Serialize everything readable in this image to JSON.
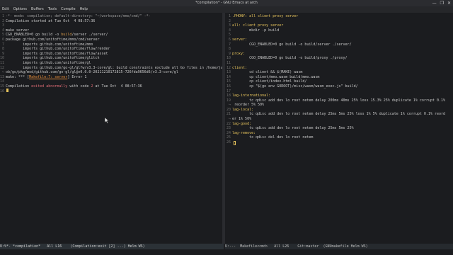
{
  "window": {
    "title": "*compilation* - GNU Emacs at arch",
    "controls": [
      "—",
      "❐",
      "✕"
    ]
  },
  "menu": [
    "Edit",
    "Options",
    "Buffers",
    "Tools",
    "Compile",
    "Help"
  ],
  "left_buffer": {
    "lines": [
      {
        "n": "1",
        "segs": [
          {
            "t": "-*- mode: compilation; default-directory: \"~/workspace/mmo/cmd/\" -*-",
            "c": "c-comment"
          }
        ]
      },
      {
        "n": "2",
        "segs": [
          {
            "t": "Compilation started at Tue Oct  4 08:57:36",
            "c": "c-plain"
          }
        ]
      },
      {
        "n": "3",
        "segs": []
      },
      {
        "n": "4",
        "segs": [
          {
            "t": "make server",
            "c": "c-plain"
          }
        ]
      },
      {
        "n": "5",
        "segs": [
          {
            "t": "CGO_ENABLED=0 go build -o ",
            "c": "c-plain"
          },
          {
            "t": "build",
            "c": "c-var"
          },
          {
            "t": "/server ./server/",
            "c": "c-plain"
          }
        ]
      },
      {
        "n": "6",
        "segs": [
          {
            "t": "package github.com/unitoftime/mmo/cmd/server",
            "c": "c-plain"
          }
        ]
      },
      {
        "n": "7",
        "segs": [
          {
            "t": "        imports github.com/unitoftime/mmo",
            "c": "c-plain"
          }
        ]
      },
      {
        "n": "8",
        "segs": [
          {
            "t": "        imports github.com/unitoftime/flow/render",
            "c": "c-plain"
          }
        ]
      },
      {
        "n": "9",
        "segs": [
          {
            "t": "        imports github.com/unitoftime/flow/asset",
            "c": "c-plain"
          }
        ]
      },
      {
        "n": "10",
        "segs": [
          {
            "t": "        imports github.com/unitoftime/glitch",
            "c": "c-plain"
          }
        ]
      },
      {
        "n": "11",
        "segs": [
          {
            "t": "        imports github.com/unitoftime/gl",
            "c": "c-plain"
          }
        ]
      },
      {
        "n": "12",
        "segs": [
          {
            "t": "        imports github.com/go-gl/glfw/v3.3-core/gl: build constraints exclude all Go files in /home/jac",
            "c": "c-plain"
          }
        ]
      },
      {
        "n": "↪",
        "segs": [
          {
            "t": "ob/go/pkg/mod/github.com/go-gl/gl@v0.0.0-20211210172815-726fda9656d6/v3.3-core/gl",
            "c": "c-plain"
          }
        ]
      },
      {
        "n": "13",
        "segs": [
          {
            "t": "make: *** [",
            "c": "c-plain"
          },
          {
            "t": "Makefile:7: server",
            "c": "c-link"
          },
          {
            "t": "] Error 1",
            "c": "c-plain"
          }
        ]
      },
      {
        "n": "14",
        "segs": []
      },
      {
        "n": "15",
        "segs": [
          {
            "t": "Compilation ",
            "c": "c-plain"
          },
          {
            "t": "exited abnormally",
            "c": "c-err"
          },
          {
            "t": " with code ",
            "c": "c-plain"
          },
          {
            "t": "2",
            "c": "c-err"
          },
          {
            "t": " at Tue Oct  4 08:57:36",
            "c": "c-plain"
          }
        ]
      },
      {
        "n": "16",
        "segs": []
      }
    ]
  },
  "right_buffer": {
    "lines": [
      {
        "n": "1",
        "segs": [
          {
            "t": ".PHONY: all client proxy server",
            "c": "c-target"
          }
        ]
      },
      {
        "n": "2",
        "segs": []
      },
      {
        "n": "3",
        "segs": [
          {
            "t": "all: client proxy server",
            "c": "c-target"
          }
        ]
      },
      {
        "n": "4",
        "segs": [
          {
            "t": "        mkdir -p build",
            "c": "c-plain"
          }
        ]
      },
      {
        "n": "5",
        "segs": []
      },
      {
        "n": "6",
        "segs": [
          {
            "t": "server:",
            "c": "c-target"
          }
        ]
      },
      {
        "n": "7",
        "segs": [
          {
            "t": "        CGO_ENABLED=0 go build -o build/server ./server/",
            "c": "c-plain"
          }
        ]
      },
      {
        "n": "8",
        "segs": []
      },
      {
        "n": "9",
        "segs": [
          {
            "t": "proxy:",
            "c": "c-target"
          }
        ]
      },
      {
        "n": "10",
        "segs": [
          {
            "t": "        CGO_ENABLED=0 go build -o build/proxy ./proxy/",
            "c": "c-plain"
          }
        ]
      },
      {
        "n": "11",
        "segs": []
      },
      {
        "n": "12",
        "segs": [
          {
            "t": "client:",
            "c": "c-target"
          }
        ]
      },
      {
        "n": "13",
        "segs": [
          {
            "t": "        cd client && $(MAKE) wasm",
            "c": "c-plain"
          }
        ]
      },
      {
        "n": "14",
        "segs": [
          {
            "t": "        cp client/mmo.wasm build/mmo.wasm",
            "c": "c-plain"
          }
        ]
      },
      {
        "n": "15",
        "segs": [
          {
            "t": "        cp client/index.html build/",
            "c": "c-plain"
          }
        ]
      },
      {
        "n": "16",
        "segs": [
          {
            "t": "        cp \"$(go env GOROOT)/misc/wasm/wasm_exec.js\" build/",
            "c": "c-plain"
          }
        ]
      },
      {
        "n": "17",
        "segs": []
      },
      {
        "n": "18",
        "segs": [
          {
            "t": "lag-international:",
            "c": "c-target"
          }
        ]
      },
      {
        "n": "19",
        "segs": [
          {
            "t": "        tc qdisc add dev lo root netem delay 200ms 40ms 25% loss 15.3% 25% duplicate 1% corrupt 0.1%",
            "c": "c-plain"
          }
        ]
      },
      {
        "n": "↪",
        "segs": [
          {
            "t": " reorder 5% 50%",
            "c": "c-plain"
          }
        ]
      },
      {
        "n": "20",
        "segs": [
          {
            "t": "lag-local:",
            "c": "c-target"
          }
        ]
      },
      {
        "n": "21",
        "segs": [
          {
            "t": "        tc qdisc add dev lo root netem delay 25ms 5ms 25% loss 1% 5% duplicate 1% corrupt 0.1% reord",
            "c": "c-plain"
          }
        ]
      },
      {
        "n": "↪",
        "segs": [
          {
            "t": "er 1% 50%",
            "c": "c-plain"
          }
        ]
      },
      {
        "n": "22",
        "segs": [
          {
            "t": "lag-good:",
            "c": "c-target"
          }
        ]
      },
      {
        "n": "23",
        "segs": [
          {
            "t": "        tc qdisc add dev lo root netem delay 25ms 5ms 25%",
            "c": "c-plain"
          }
        ]
      },
      {
        "n": "24",
        "segs": [
          {
            "t": "lag-remove:",
            "c": "c-target"
          }
        ]
      },
      {
        "n": "25",
        "segs": [
          {
            "t": "        tc qdisc del dev lo root netem",
            "c": "c-plain"
          }
        ]
      },
      {
        "n": "26",
        "segs": []
      }
    ]
  },
  "modeline_left": "U:%*- *compilation*   All L16    (Compilation:exit [2] ...) Helm WS)",
  "modeline_right": "U:---  Makefile<cmd>   All L26    Git:master  (GNUmakefile Helm WS)"
}
